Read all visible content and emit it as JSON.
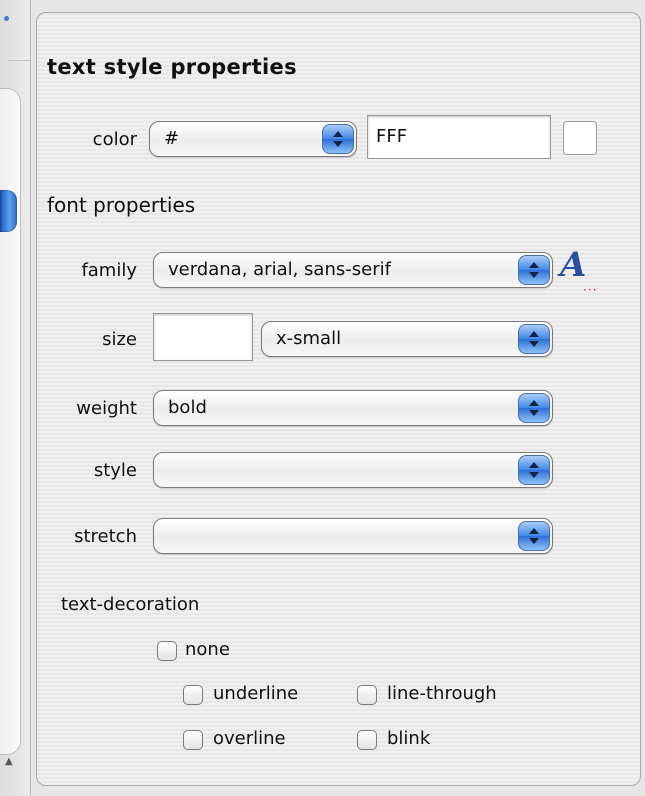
{
  "heading": "text style properties",
  "color": {
    "label": "color",
    "format_value": "#",
    "value": "FFF",
    "swatch_hex": "#FFFFFF"
  },
  "font_section": "font properties",
  "family": {
    "label": "family",
    "value": "verdana, arial, sans-serif",
    "icon": "font-panel-icon",
    "icon_glyph": "A"
  },
  "size": {
    "label": "size",
    "input_value": "",
    "unit_value": "x-small"
  },
  "weight": {
    "label": "weight",
    "value": "bold"
  },
  "style": {
    "label": "style",
    "value": ""
  },
  "stretch": {
    "label": "stretch",
    "value": ""
  },
  "text_decoration": {
    "label": "text-decoration",
    "options": {
      "none": "none",
      "underline": "underline",
      "line_through": "line-through",
      "overline": "overline",
      "blink": "blink"
    }
  }
}
